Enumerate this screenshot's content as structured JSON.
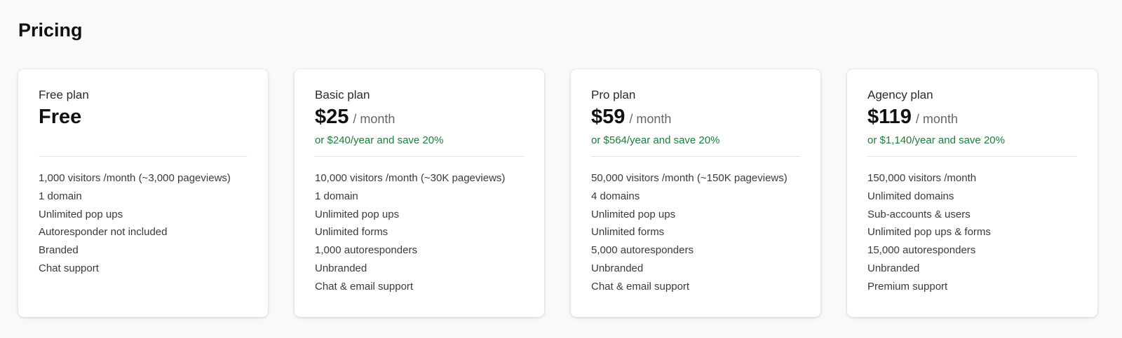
{
  "page": {
    "title": "Pricing"
  },
  "colors": {
    "background": "#f9f9f8",
    "card": "#ffffff",
    "annual_text": "#1e7b3a",
    "divider": "#e3e3e3"
  },
  "plans": [
    {
      "name": "Free plan",
      "price": "Free",
      "period": "",
      "annual": "",
      "features": [
        "1,000 visitors /month (~3,000 pageviews)",
        "1 domain",
        "Unlimited pop ups",
        "Autoresponder not included",
        "Branded",
        "Chat support"
      ]
    },
    {
      "name": "Basic plan",
      "price": "$25",
      "period": "/ month",
      "annual": "or $240/year and save 20%",
      "features": [
        "10,000 visitors /month (~30K pageviews)",
        "1 domain",
        "Unlimited pop ups",
        "Unlimited forms",
        "1,000 autoresponders",
        "Unbranded",
        "Chat & email support"
      ]
    },
    {
      "name": "Pro plan",
      "price": "$59",
      "period": "/ month",
      "annual": "or $564/year and save 20%",
      "features": [
        "50,000 visitors /month (~150K pageviews)",
        "4 domains",
        "Unlimited pop ups",
        "Unlimited forms",
        "5,000 autoresponders",
        "Unbranded",
        "Chat & email support"
      ]
    },
    {
      "name": "Agency plan",
      "price": "$119",
      "period": "/ month",
      "annual": "or $1,140/year and save 20%",
      "features": [
        "150,000 visitors /month",
        "Unlimited domains",
        "Sub-accounts & users",
        "Unlimited pop ups & forms",
        "15,000 autoresponders",
        "Unbranded",
        "Premium support"
      ]
    }
  ]
}
